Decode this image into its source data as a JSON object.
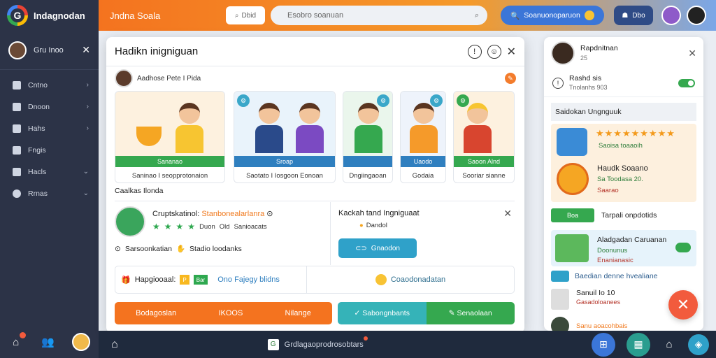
{
  "app": {
    "brand": "Indagnodan",
    "title": "Jndna Soala"
  },
  "sidebar": {
    "user": {
      "name": "Gru Inoo"
    },
    "items": [
      {
        "label": "Cntno",
        "icon": "home-icon",
        "expand": "›"
      },
      {
        "label": "Dnoon",
        "icon": "grid-icon",
        "expand": "›"
      },
      {
        "label": "Hahs",
        "icon": "chart-icon",
        "expand": "›"
      },
      {
        "label": "Fngis",
        "icon": "folder-icon",
        "expand": ""
      },
      {
        "label": "Hacls",
        "icon": "flag-icon",
        "expand": "⌄"
      },
      {
        "label": "Rrnas",
        "icon": "target-icon",
        "expand": "⌄"
      }
    ]
  },
  "topbar": {
    "chip_label": "Dbid",
    "search_placeholder": "Esobro soanuan",
    "action_label": "Soanuonoparuon",
    "msg_label": "Dbo"
  },
  "modal": {
    "title": "Hadikn inigniguan",
    "user_line": "Aadhose Pete I Pida",
    "cards": [
      {
        "stripe": "Sananao",
        "caption": "Saninao I seopprotonaion",
        "stripe_color": "#35a84f"
      },
      {
        "stripe": "Sroap",
        "caption": "Saotato I Iosgoon Eonoan",
        "stripe_color": "#2f7fbf"
      },
      {
        "stripe": "",
        "caption": "Dngiingaoan",
        "stripe_color": "#2f7fbf"
      },
      {
        "stripe": "Uaodo",
        "caption": "Godaia",
        "stripe_color": "#2f7fbf"
      },
      {
        "stripe": "Saoon Alnd",
        "caption": "Sooriar sianne",
        "stripe_color": "#35a84f"
      }
    ],
    "section_title": "Caalkas Ilonda",
    "profile": {
      "name": "Cruptskatinol:",
      "name_accent": "Stanbonealarlanra",
      "rating_text": "Duon",
      "tag1": "Old",
      "tag2": "Sanioacats",
      "footer": "Sarsoonkatian",
      "footer2": "Stadio loodanks"
    },
    "sub": {
      "title": "Kackah tand Ingniguaat",
      "status": "Dandol",
      "button": "Gnaodon"
    },
    "info": {
      "label": "Hapgiooaal:",
      "chip1": "P",
      "chip2": "Bar",
      "link": "Ono Fajegy blidns",
      "right": "Coaodonadatan"
    },
    "actions": {
      "orange": [
        "Bodagoslan",
        "IKOOS",
        "Nilange"
      ],
      "teal": "Sabongnbants",
      "green": "Senaolaan"
    }
  },
  "panel": {
    "header_name": "Rapdnitnan",
    "header_sub": "25",
    "row_title": "Rashd sis",
    "row_sub": "Tnolanhs 903",
    "section": "Saidokan Ungnguuk",
    "reward": {
      "line1": "Saoisa toaaoih",
      "title": "Haudk Soaano",
      "line2": "Sa Toodasa 20.",
      "line3": "Saarao"
    },
    "pill": {
      "chip": "Boa",
      "text": "Tarpali onpdotids"
    },
    "promo": {
      "title": "Aladgadan Caruanan",
      "line1": "Doonunus",
      "line2": "Enanianasic"
    },
    "link": "Baedian denne hvealiane",
    "item": {
      "title": "Sanuil Io 10",
      "sub": "Gasadoloanees"
    },
    "item2": "Sanu aoacohbais"
  },
  "bottombar": {
    "task_label": "Grdlagaoprodrosobtars"
  }
}
